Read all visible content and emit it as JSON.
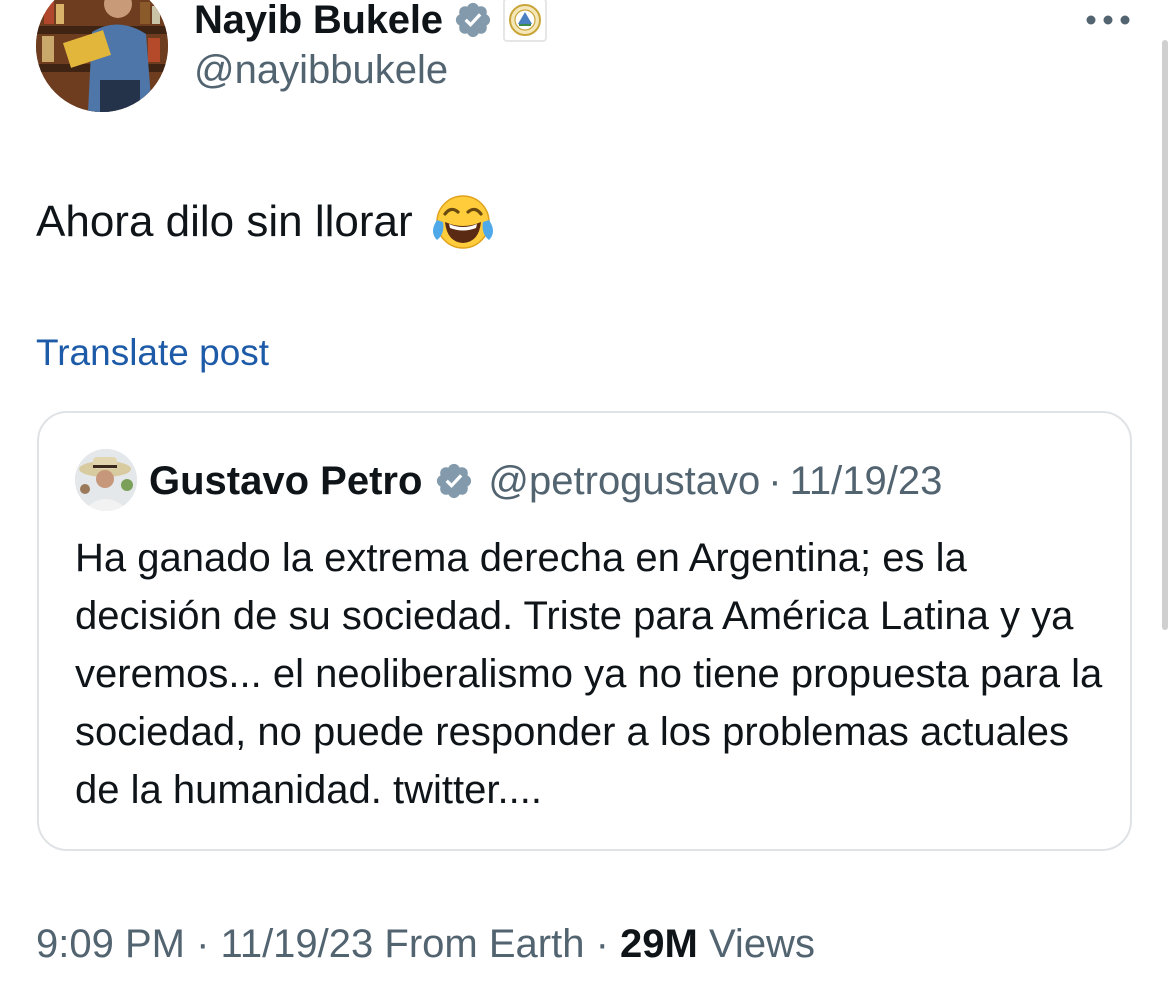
{
  "post": {
    "author_name": "Nayib Bukele",
    "author_handle": "@nayibbukele",
    "text": "Ahora dilo sin llorar",
    "emoji": "face-with-tears-of-joy-icon",
    "translate_label": "Translate post",
    "time": "9:09 PM",
    "date": "11/19/23",
    "source": "From Earth",
    "views_count": "29M",
    "views_label": "Views"
  },
  "quote": {
    "author_name": "Gustavo Petro",
    "author_handle": "@petrogustavo",
    "date": "11/19/23",
    "text": "Ha ganado la extrema derecha en Argentina; es la decisión de su sociedad. Triste para América Latina y ya veremos... el neoliberalismo ya no tiene propuesta para la sociedad, no puede responder a los problemas actuales de la humanidad. twitter...."
  },
  "separator": "·",
  "icons": {
    "verified": "verified-badge-icon",
    "affiliate": "el-salvador-seal-icon",
    "more": "more-options-icon"
  },
  "colors": {
    "text_primary": "#0f1419",
    "text_secondary": "#536471",
    "link": "#1d5ba8",
    "verified_badge": "#829aab",
    "card_border": "#dfe3e6"
  }
}
